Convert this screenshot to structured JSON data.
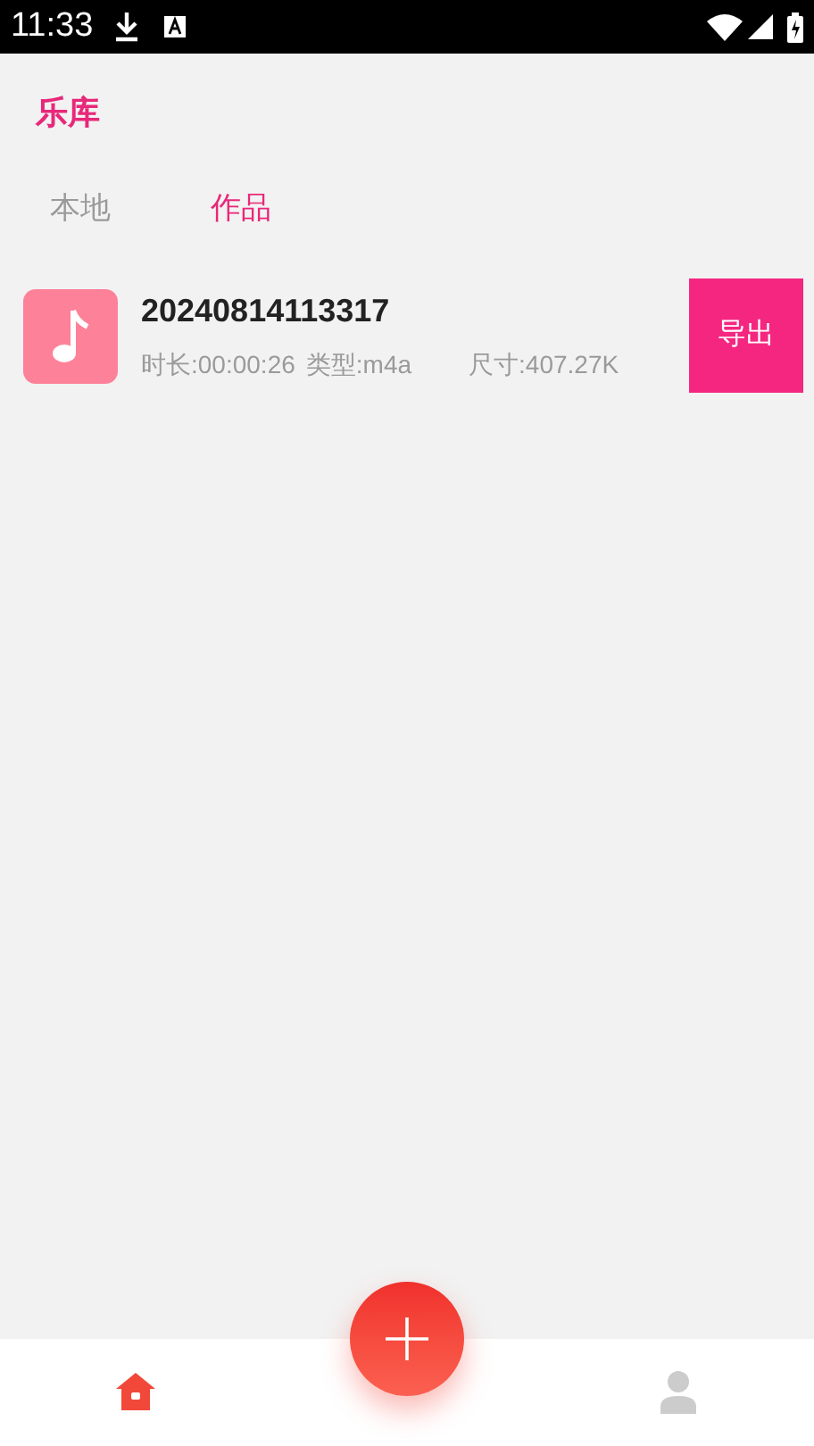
{
  "status_bar": {
    "time": "11:33"
  },
  "title": "乐库",
  "tabs": [
    {
      "label": "本地",
      "selected": false
    },
    {
      "label": "作品",
      "selected": true
    }
  ],
  "items": [
    {
      "name": "20240814113317",
      "duration": "时长:00:00:26",
      "type": "类型:m4a",
      "size": "尺寸:407.27K",
      "action": "导出"
    }
  ],
  "bottom_nav": [
    {
      "kind": "home",
      "selected": true
    },
    {
      "kind": "profile",
      "selected": false
    }
  ]
}
